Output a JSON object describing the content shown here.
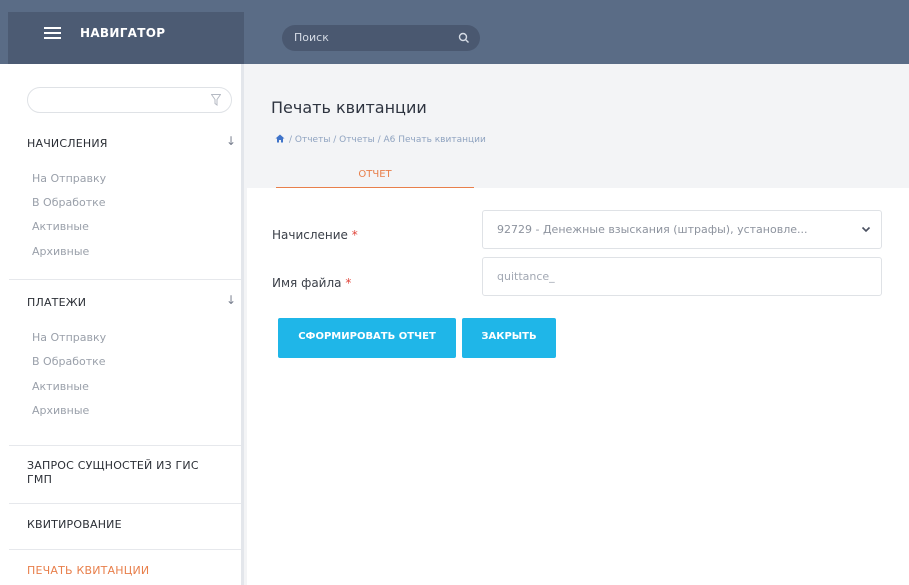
{
  "header": {
    "brand": "НАВИГАТОР",
    "search_placeholder": "Поиск"
  },
  "sidebar": {
    "sections": [
      {
        "label": "НАЧИСЛЕНИЯ",
        "items": [
          "На Отправку",
          "В Обработке",
          "Активные",
          "Архивные"
        ]
      },
      {
        "label": "ПЛАТЕЖИ",
        "items": [
          "На Отправку",
          "В Обработке",
          "Активные",
          "Архивные"
        ]
      }
    ],
    "links": [
      "ЗАПРОС СУЩНОСТЕЙ ИЗ ГИС ГМП",
      "КВИТИРОВАНИЕ",
      "ПЕЧАТЬ КВИТАНЦИИ"
    ]
  },
  "page": {
    "title": "Печать квитанции",
    "breadcrumb": "/ Отчеты / Отчеты / А6 Печать квитанции",
    "tab": "ОТЧЕТ"
  },
  "form": {
    "accrual_label": "Начисление",
    "accrual_value": "92729 - Денежные взыскания (штрафы), установле...",
    "filename_label": "Имя файла",
    "filename_placeholder": "quittance_",
    "required_mark": "*"
  },
  "buttons": {
    "generate": "СФОРМИРОВАТЬ ОТЧЕТ",
    "close": "ЗАКРЫТЬ"
  },
  "colors": {
    "accent": "#e87f4b",
    "primary": "#1fb6e8",
    "topbar": "#5a6c86"
  }
}
